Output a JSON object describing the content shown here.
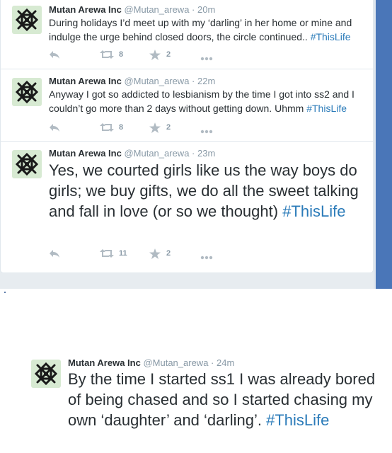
{
  "tweets": [
    {
      "name": "Mutan Arewa Inc",
      "handle": "@Mutan_arewa",
      "time": "20m",
      "text": "During holidays I’d meet up with my ‘darling’ in her home or mine and indulge the urge behind closed doors, the circle continued.. ",
      "hashtag": "#ThisLife",
      "retweets": "8",
      "favorites": "2"
    },
    {
      "name": "Mutan Arewa Inc",
      "handle": "@Mutan_arewa",
      "time": "22m",
      "text": "Anyway I got so addicted to lesbianism by the time I got into ss2 and I couldn’t go more than 2 days without getting down. Uhmm ",
      "hashtag": "#ThisLife",
      "retweets": "8",
      "favorites": "2"
    },
    {
      "name": "Mutan Arewa Inc",
      "handle": "@Mutan_arewa",
      "time": "23m",
      "text": "Yes, we courted girls like us the way boys do girls; we buy gifts, we do all the sweet talking and fall in love (or so we thought) ",
      "hashtag": "#ThisLife",
      "retweets": "11",
      "favorites": "2"
    },
    {
      "name": "Mutan Arewa Inc",
      "handle": "@Mutan_arewa",
      "time": "24m",
      "text": "By the time I started ss1 I was already bored of being chased and so I started chasing my own ‘daughter’ and ‘darling’. ",
      "hashtag": "#ThisLife"
    }
  ],
  "icons": {
    "reply": "reply-icon",
    "retweet": "retweet-icon",
    "favorite": "star-icon",
    "more": "more-icon",
    "avatar": "knot-logo"
  },
  "colors": {
    "hashtag": "#2b7bb9",
    "name": "#292f33",
    "meta": "#8899a6",
    "action_icon": "#b1bbc3",
    "avatar_bg": "#d7ead2",
    "page_bg": "#e7ecf0",
    "right_strip": "#4a76b8"
  }
}
